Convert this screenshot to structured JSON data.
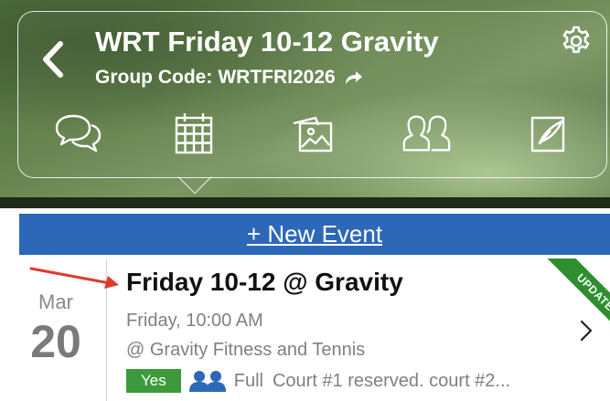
{
  "header": {
    "title": "WRT Friday 10-12 Gravity",
    "group_code_label": "Group Code:",
    "group_code": "WRTFRI2026"
  },
  "tabs": [
    {
      "icon": "chat-bubbles-icon",
      "active": false
    },
    {
      "icon": "calendar-icon",
      "active": true
    },
    {
      "icon": "photos-icon",
      "active": false
    },
    {
      "icon": "members-icon",
      "active": false
    },
    {
      "icon": "notes-icon",
      "active": false
    }
  ],
  "new_event": {
    "label": "+ New Event"
  },
  "event": {
    "month": "Mar",
    "day": "20",
    "title": "Friday 10-12 @ Gravity",
    "time": "Friday, 10:00 AM",
    "location": "@ Gravity Fitness and Tennis",
    "rsvp": "Yes",
    "status": "Full",
    "note": "Court #1 reserved. court #2...",
    "ribbon": "UPDATE"
  },
  "colors": {
    "accent_blue": "#2d68b8",
    "rsvp_green": "#3c9a3c",
    "ribbon_green": "#2f8f2f",
    "people_blue": "#2d68b8",
    "arrow_red": "#e03a2c"
  }
}
